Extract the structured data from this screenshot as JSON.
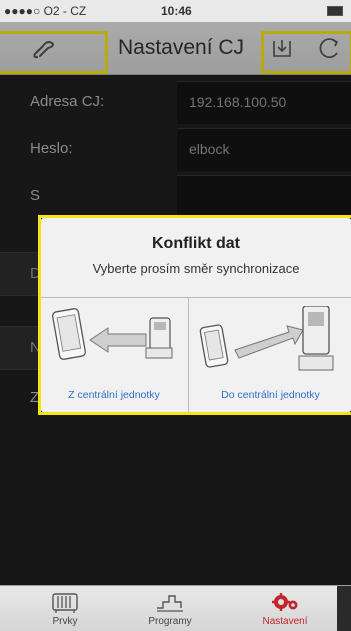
{
  "status_bar": {
    "carrier": "●●●●○ O2 - CZ",
    "time": "10:46"
  },
  "nav": {
    "title": "Nastavení CJ",
    "icons": [
      "sync-link-icon",
      "download-icon",
      "refresh-icon"
    ]
  },
  "form": {
    "address_label": "Adresa CJ:",
    "address_value": "192.168.100.50",
    "password_label": "Heslo:",
    "password_value": "elbock",
    "row3_letter": "S",
    "row4_letter": "D",
    "row5_letter": "N",
    "row6_letter": "Z"
  },
  "dialog": {
    "title": "Konflikt dat",
    "message": "Vyberte prosím směr synchronizace",
    "left_option": "Z centrální jednotky",
    "right_option": "Do centrální jednotky"
  },
  "tab_bar": {
    "tabs": [
      {
        "label": "Prvky",
        "icon": "radiator-icon"
      },
      {
        "label": "Programy",
        "icon": "program-icon"
      },
      {
        "label": "Nastavení",
        "icon": "gears-icon"
      }
    ],
    "active_color": "#c1262b"
  },
  "colors": {
    "highlight": "#f4e413",
    "link": "#2e6fc9"
  }
}
